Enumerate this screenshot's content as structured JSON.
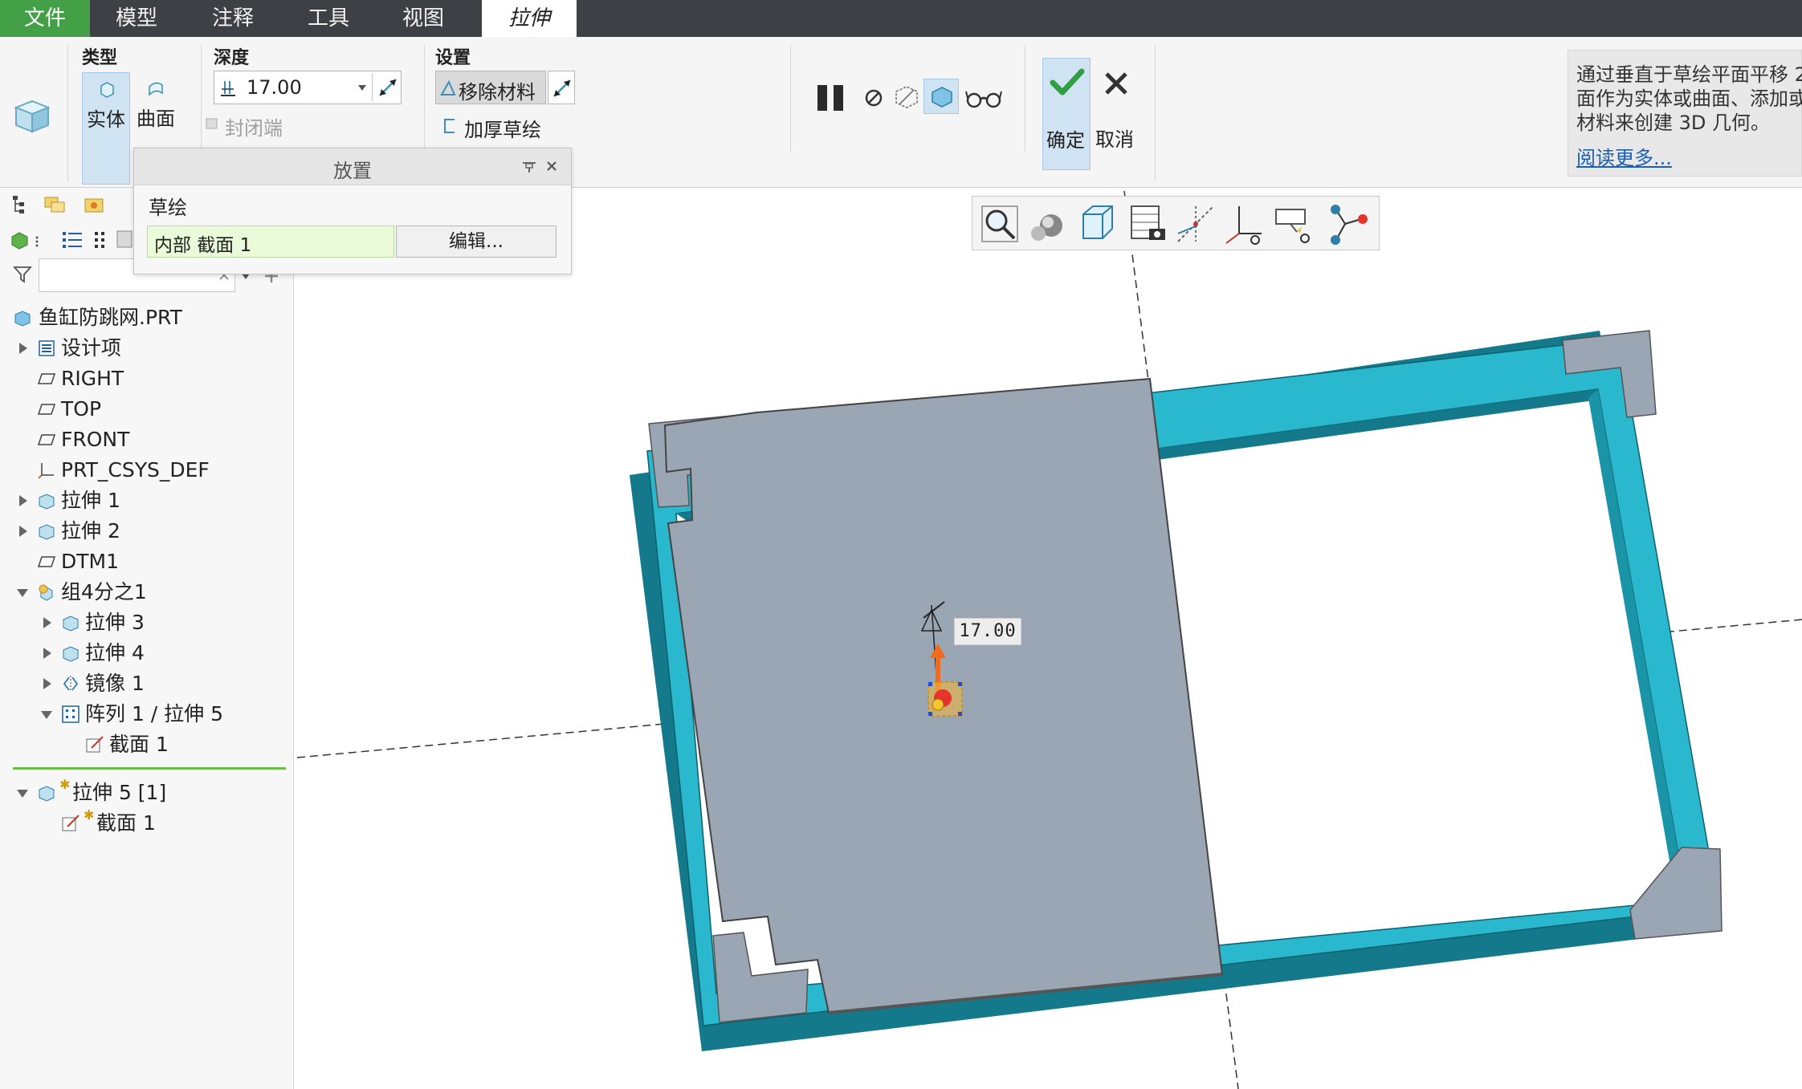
{
  "menu": {
    "file": "文件",
    "model": "模型",
    "annotate": "注释",
    "tools": "工具",
    "view": "视图",
    "extrude": "拉伸"
  },
  "ribbon": {
    "type_title": "类型",
    "solid": "实体",
    "surface": "曲面",
    "depth_title": "深度",
    "depth_value": "17.00",
    "capped_ends": "封闭端",
    "settings_title": "设置",
    "remove_material": "移除材料",
    "thicken_sketch": "加厚草绘",
    "ok": "确定",
    "cancel": "取消"
  },
  "help": {
    "line1": "通过垂直于草绘平面平移 2",
    "line2": "面作为实体或曲面、添加或",
    "line3": "材料来创建 3D 几何。",
    "read_more": "阅读更多..."
  },
  "placement": {
    "title": "放置",
    "sketch_label": "草绘",
    "sketch_value": "内部 截面 1",
    "edit_button": "编辑..."
  },
  "tree": {
    "root": "鱼缸防跳网.PRT",
    "items": [
      {
        "label": "设计项"
      },
      {
        "label": "RIGHT"
      },
      {
        "label": "TOP"
      },
      {
        "label": "FRONT"
      },
      {
        "label": "PRT_CSYS_DEF"
      },
      {
        "label": "拉伸 1"
      },
      {
        "label": "拉伸 2"
      },
      {
        "label": "DTM1"
      },
      {
        "label": "组4分之1"
      },
      {
        "label": "拉伸 3"
      },
      {
        "label": "拉伸 4"
      },
      {
        "label": "镜像 1"
      },
      {
        "label": "阵列 1 / 拉伸 5"
      },
      {
        "label": "截面 1"
      },
      {
        "label": "拉伸 5 [1]"
      },
      {
        "label": "截面 1"
      }
    ]
  },
  "viewport": {
    "dimension": "17.00"
  },
  "colors": {
    "menu_bg": "#3d4145",
    "file_tab": "#43a047",
    "plate": "#9aa6b3",
    "frame_top": "#2ab8cf",
    "frame_side": "#147a8b",
    "selected_bg": "#cfe3f3",
    "link": "#1a5fb4"
  }
}
